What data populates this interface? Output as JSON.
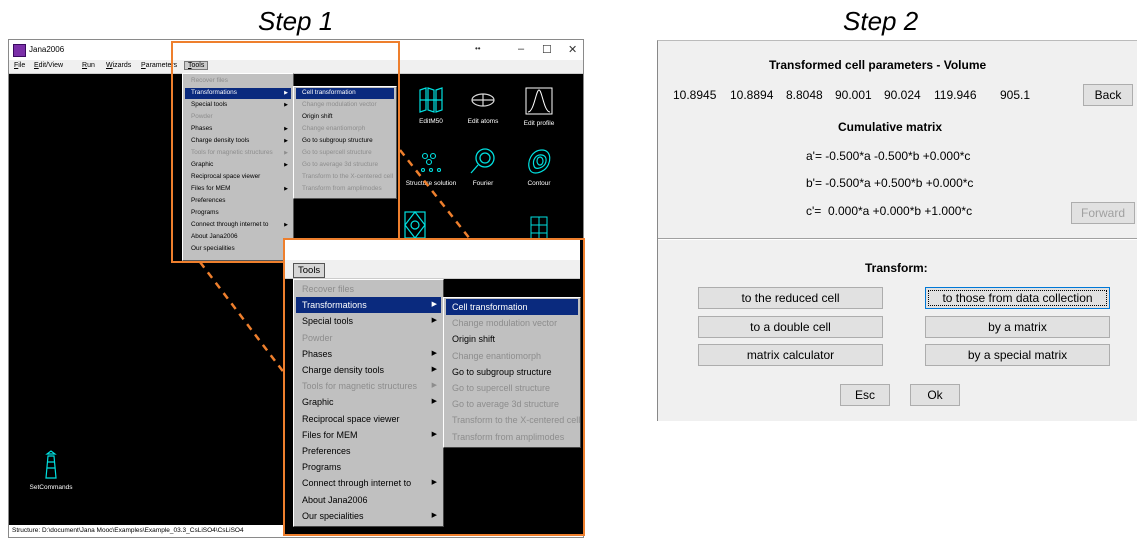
{
  "steps": {
    "step1": "Step 1",
    "step2": "Step 2"
  },
  "jana": {
    "title": "Jana2006",
    "window_buttons": {
      "extra": "••",
      "minimize": "–",
      "maximize": "☐",
      "close": "✕"
    },
    "menubar": [
      "File",
      "Edit/View",
      "Run",
      "Wizards",
      "Parameters",
      "Tools"
    ],
    "icons": [
      {
        "label": "EditM50",
        "icon": "edit-m50-icon"
      },
      {
        "label": "Edit atoms",
        "icon": "edit-atoms-icon"
      },
      {
        "label": "Edit profile",
        "icon": "edit-profile-icon"
      },
      {
        "label": "Structure solution",
        "icon": "structure-solution-icon"
      },
      {
        "label": "Fourier",
        "icon": "fourier-icon"
      },
      {
        "label": "Contour",
        "icon": "contour-icon"
      },
      {
        "label": "SetCommands",
        "icon": "lighthouse-icon"
      }
    ],
    "status": "Structure: D:\\document\\Jana Mooc\\Examples\\Example_03.3_CsLiSO4\\CsLiSO4"
  },
  "tools_menu": {
    "label": "Tools",
    "items": [
      {
        "label": "Recover files",
        "disabled": true,
        "submenu": false
      },
      {
        "label": "Transformations",
        "disabled": false,
        "submenu": true,
        "selected": true
      },
      {
        "label": "Special tools",
        "disabled": false,
        "submenu": true
      },
      {
        "label": "Powder",
        "disabled": true,
        "submenu": false
      },
      {
        "label": "Phases",
        "disabled": false,
        "submenu": true
      },
      {
        "label": "Charge density tools",
        "disabled": false,
        "submenu": true
      },
      {
        "label": "Tools for magnetic structures",
        "disabled": true,
        "submenu": true
      },
      {
        "label": "Graphic",
        "disabled": false,
        "submenu": true
      },
      {
        "label": "Reciprocal space viewer",
        "disabled": false,
        "submenu": false
      },
      {
        "label": "Files for MEM",
        "disabled": false,
        "submenu": true
      },
      {
        "label": "Preferences",
        "disabled": false,
        "submenu": false
      },
      {
        "label": "Programs",
        "disabled": false,
        "submenu": false
      },
      {
        "label": "Connect through internet to",
        "disabled": false,
        "submenu": true
      },
      {
        "label": "About Jana2006",
        "disabled": false,
        "submenu": false
      },
      {
        "label": "Our specialities",
        "disabled": false,
        "submenu": true
      }
    ],
    "transform_submenu": [
      {
        "label": "Cell transformation",
        "disabled": false,
        "selected": true
      },
      {
        "label": "Change modulation vector",
        "disabled": true
      },
      {
        "label": "Origin shift",
        "disabled": false
      },
      {
        "label": "Change enantiomorph",
        "disabled": true
      },
      {
        "label": "Go to subgroup structure",
        "disabled": false
      },
      {
        "label": "Go to supercell structure",
        "disabled": true
      },
      {
        "label": "Go to average 3d structure",
        "disabled": true
      },
      {
        "label": "Transform to the X-centered cell",
        "disabled": true
      },
      {
        "label": "Transform from amplimodes",
        "disabled": true
      }
    ]
  },
  "dialog": {
    "heading": "Transformed cell parameters - Volume",
    "params": [
      "10.8945",
      "10.8894",
      "8.8048",
      "90.001",
      "90.024",
      "119.946",
      "905.1"
    ],
    "back": "Back",
    "cumulative": "Cumulative matrix",
    "rows": [
      "a'= -0.500*a -0.500*b +0.000*c",
      "b'= -0.500*a +0.500*b +0.000*c",
      "c'=  0.000*a +0.000*b +1.000*c"
    ],
    "forward": "Forward",
    "transform_label": "Transform:",
    "buttons": {
      "reduced": "to the reduced cell",
      "data_collection": "to those from data collection",
      "double": "to a double cell",
      "matrix": "by a matrix",
      "calculator": "matrix calculator",
      "special": "by a special matrix"
    },
    "esc": "Esc",
    "ok": "Ok"
  },
  "colors": {
    "highlight": "#0a2a7e",
    "accent": "#ee7f2d",
    "menu": "#c0c0c0"
  }
}
